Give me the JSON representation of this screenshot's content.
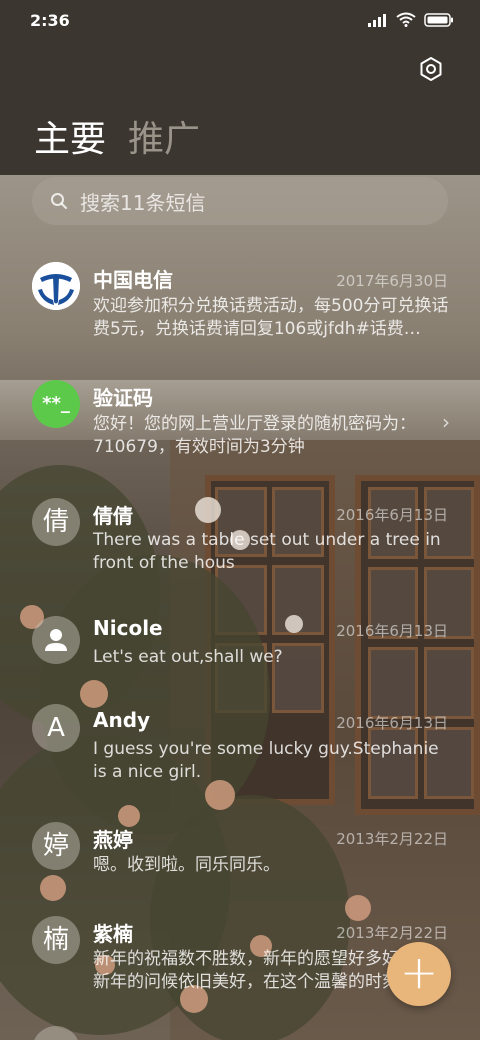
{
  "status_bar": {
    "time": "2:36"
  },
  "tabs": [
    {
      "label": "主要"
    },
    {
      "label": "推广"
    }
  ],
  "search": {
    "placeholder": "搜索11条短信"
  },
  "messages": [
    {
      "name": "中国电信",
      "date": "2017年6月30日",
      "preview": "欢迎参加积分兑换话费活动，每500分可兑换话费5元，兑换话费请回复106或jfdh#话费…",
      "avatar_text": ""
    },
    {
      "name": "验证码",
      "date": "",
      "preview": "您好！您的网上营业厅登录的随机密码为：710679，有效时间为3分钟",
      "avatar_text": "**_"
    },
    {
      "name": "倩倩",
      "date": "2016年6月13日",
      "preview": "There was a table set out under a tree in front of the hous",
      "avatar_text": "倩"
    },
    {
      "name": "Nicole",
      "date": "2016年6月13日",
      "preview": "Let's eat out,shall we?",
      "avatar_text": ""
    },
    {
      "name": "Andy",
      "date": "2016年6月13日",
      "preview": "I guess you're some lucky guy.Stephanie is a nice girl.",
      "avatar_text": "A"
    },
    {
      "name": "燕婷",
      "date": "2013年2月22日",
      "preview": "嗯。收到啦。同乐同乐。",
      "avatar_text": "婷"
    },
    {
      "name": "紫楠",
      "date": "2013年2月22日",
      "preview": "新年的祝福数不胜数，新年的愿望好多好多，新年的问候依旧美好，在这个温馨的时刻…",
      "avatar_text": "楠"
    }
  ],
  "fab": {
    "label": "+"
  },
  "colors": {
    "header_bg": "#3b3630",
    "fab": "#e8b57a",
    "verify_avatar": "#5cc94a",
    "telecom_blue": "#1a4f9c"
  }
}
